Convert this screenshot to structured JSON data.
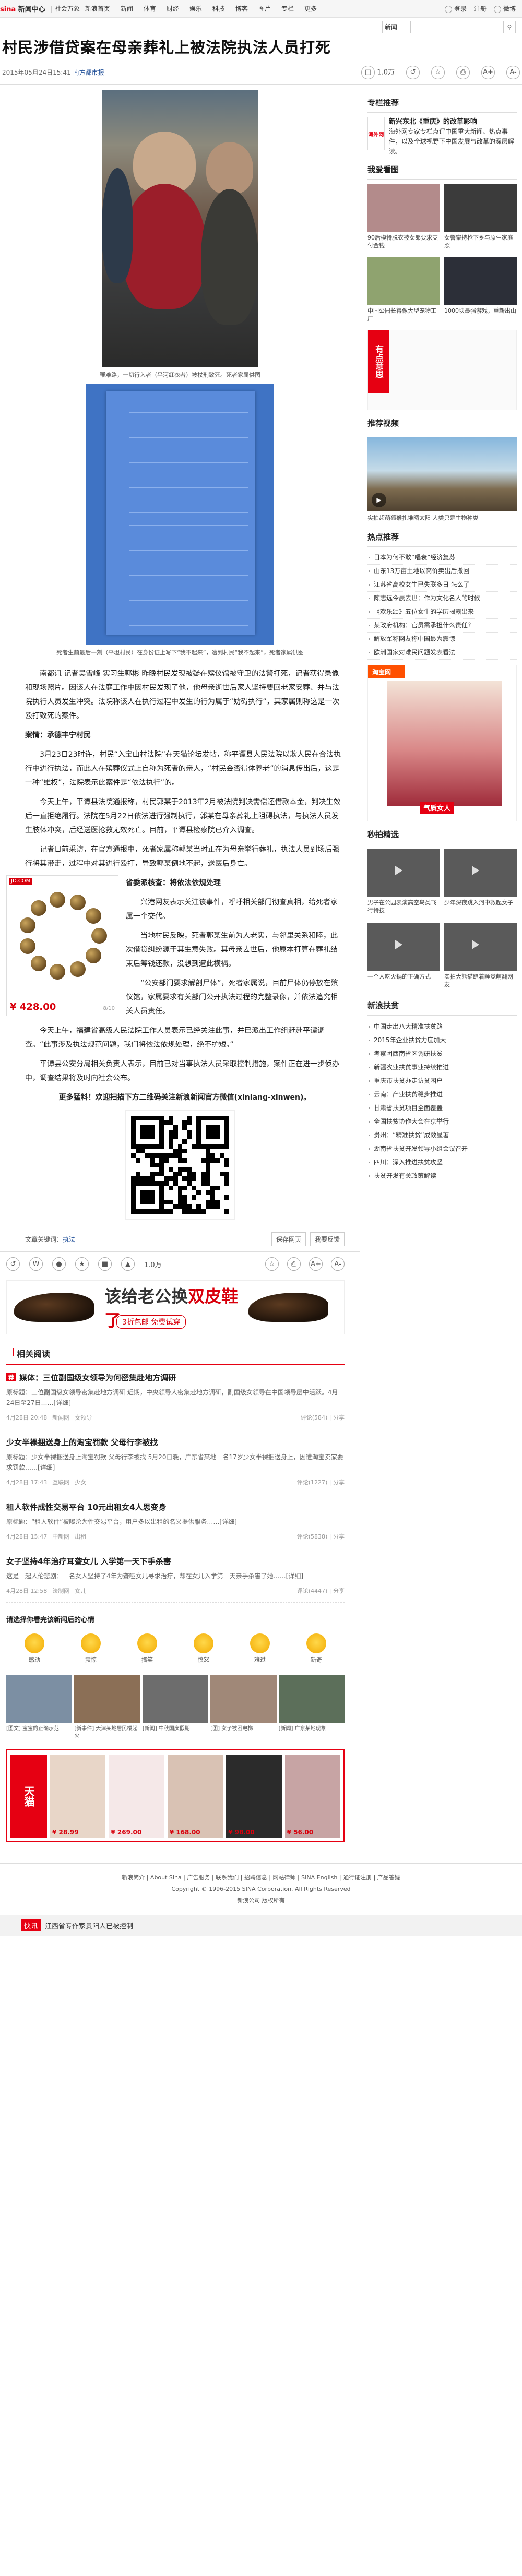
{
  "topbar": {
    "logo": "sina",
    "logo_suffix": "新闻中心",
    "site_link": "社会万象",
    "nav": [
      "新浪首页",
      "新闻",
      "体育",
      "财经",
      "娱乐",
      "科技",
      "博客",
      "图片",
      "专栏",
      "更多"
    ],
    "login": "登录",
    "register": "注册",
    "weibo": "微博"
  },
  "search": {
    "scope": "新闻",
    "placeholder": ""
  },
  "article": {
    "title": "村民涉借贷案在母亲葬礼上被法院执法人员打死",
    "datetime": "2015年05月24日15:41",
    "source": "南方都市报",
    "comment_count": "1.0万",
    "caption1": "罹难路，一切行入者（平河红衣者）被杖刑致死。死者家属供图",
    "caption2": "死者生前最后一刻（平坦村民）在身份证上写下“我不起来”，遭到村民“我不起来”，死者家属供图",
    "paragraphs": [
      "南都讯 记者吴雪峰 实习生郭彬 昨晚村民发现被疑在殡仪馆被守卫的法警打死，记者获得录像和现场照片。因该人在法庭工作中因村民发现了他，他母亲逝世后家人坚持要回老家安葬、并与法院执行人员发生冲突。法院称该人在执行过程中发生的行为属于“妨碍执行”，其家属则称这是一次殴打致死的案件。",
      "案情：承德丰宁村民",
      "3月23日23时许，村民“入宝山村法院”在天猫论坛发帖，称平谭县人民法院以欺人民在合法执行中进行执法，而此人在殡葬仪式上自称为死者的亲人，“村民会否得体养老”的消息传出后，这是一种“维权”，法院表示此案件是“依法执行”的。",
      "今天上午，平谭县法院通报称，村民郭某于2013年2月被法院判决需偿还借款本金，判决生效后一直拒绝履行。法院在5月22日依法进行强制执行，郭某在母亲葬礼上阻碍执法，与执法人员发生肢体冲突，后经送医抢救无效死亡。目前，平谭县检察院已介入调查。",
      "记者日前采访，在官方通报中，死者家属称郭某当时正在为母亲举行葬礼，执法人员到场后强行将其带走，过程中对其进行殴打，导致郭某倒地不起，送医后身亡。",
      "兴港网友表示关注该事件，呼吁相关部门彻查真相，给死者家属一个交代。",
      "当地村民反映，死者郭某生前为人老实，与邻里关系和睦，此次借贷纠纷源于其生意失败。其母亲去世后，他原本打算在葬礼结束后筹钱还款，没想到遭此横祸。",
      "“公安部门要求解剖尸体”，死者家属说，目前尸体仍停放在殡仪馆，家属要求有关部门公开执法过程的完整录像，并依法追究相关人员责任。",
      "今天上午，福建省高级人民法院工作人员表示已经关注此事，并已派出工作组赶赴平谭调查。“此事涉及执法规范问题，我们将依法依规处理，绝不护短。”",
      "平谭县公安分局相关负责人表示，目前已对当事执法人员采取控制措施，案件正在进一步侦办中，调查结果将及时向社会公布。"
    ],
    "subhead2": "省委派核查：将依法依规处理",
    "qr_text": "更多猛料！欢迎扫描下方二维码关注新浪新闻官方微信(xinlang-xinwen)。",
    "editor": "文章关键词：",
    "editor_name": "执法",
    "tag_buttons": [
      "保存网页",
      "我要反馈"
    ],
    "share_count": "1.0万",
    "share_likes": "我要评论"
  },
  "ads": {
    "jade_brand": "JD.COM",
    "jade_price": "¥ 428.00",
    "jade_page": "8/10",
    "shoe_text1": "该给老公换",
    "shoe_text2": "双皮鞋了",
    "shoe_sub": "3折包邮 免费试穿"
  },
  "related": {
    "heading": "相关阅读",
    "items": [
      {
        "tag": "荐",
        "title": "媒体：三位副国级女领导为何密集赴地方调研",
        "desc": "原标题：三位副国级女领导密集赴地方调研 近期，中央领导人密集赴地方调研，副国级女领导在中国领导层中活跃。4月24日至27日……[详细]",
        "time": "4月28日 20:48",
        "src": "新闻网",
        "tags": "女领导",
        "meta": "评论(584) | 分享"
      },
      {
        "tag": "",
        "title": "少女半裸捆送身上的淘宝罚款 父母行李被找",
        "desc": "原标题：少女半裸捆送身上淘宝罚款 父母行李被找 5月20日晚，广东省某地一名17岁少女半裸捆送身上，因遭淘宝卖家要求罚款……[详细]",
        "time": "4月28日 17:43",
        "src": "互联网",
        "tags": "少女",
        "meta": "评论(1227) | 分享"
      },
      {
        "tag": "",
        "title": "租人软件成性交易平台 10元出租女4人思变身",
        "desc": "原标题：“租人软件”被曝沦为性交易平台，用户多以出租的名义提供服务……[详细]",
        "time": "4月28日 15:47",
        "src": "中新网",
        "tags": "出租",
        "meta": "评论(5838) | 分享"
      },
      {
        "tag": "",
        "title": "女子坚持4年治疗耳聋女儿 入学第一天下手杀害",
        "desc": "这是一起人伦悲剧：一名女人坚持了4年为聋哑女儿寻求治疗，却在女儿入学第一天亲手杀害了她……[详细]",
        "time": "4月28日 12:58",
        "src": "法制网",
        "tags": "女儿",
        "meta": "评论(4447) | 分享"
      }
    ]
  },
  "mood": {
    "heading": "请选择你看完该新闻后的心情",
    "faces": [
      "感动",
      "震惊",
      "搞笑",
      "愤怒",
      "难过",
      "新奇"
    ]
  },
  "pics": [
    {
      "c": "[图文] 宝宝的正确示范"
    },
    {
      "c": "[新事件] 天津某地居民楼起火"
    },
    {
      "c": "[新闻] 中秋国庆假期"
    },
    {
      "c": "[图] 女子被困电梯"
    },
    {
      "c": "[新闻] 广东某地现象"
    }
  ],
  "tmall": {
    "label": "天猫",
    "prices": [
      "¥ 28.99",
      "¥ 269.00",
      "¥ 168.00",
      "¥ 98.00",
      "¥ 56.00"
    ]
  },
  "footer": {
    "links": "新浪简介 | About Sina | 广告服务 | 联系我们 | 招聘信息 | 网站律师 | SINA English | 通行证注册 | 产品答疑",
    "copyright": "Copyright © 1996-2015 SINA Corporation, All Rights Reserved",
    "copyright2": "新浪公司 版权所有"
  },
  "bottombar": {
    "tag": "快讯",
    "text": "江西省专作家贵阳人已被控制"
  },
  "sidebar": {
    "ad_heading": "专栏推荐",
    "ad_logo": "海外网",
    "ad_title": "新兴东北《重庆》的改革影响",
    "ad_desc": "海外网专家专栏点评中国重大新闻、热点事件，以及全球视野下中国发展与改革的深层解读。",
    "hot_heading": "我爱看图",
    "grid": [
      {
        "c": "90后模特脱衣被女郎要求支付金钱"
      },
      {
        "c": "女警察持枪下乡与原生家庭照"
      },
      {
        "c": "中国公园长得像大型宠物工厂"
      },
      {
        "c": "1000块最强游戏，重新出山"
      }
    ],
    "video_heading": "推荐视频",
    "video_caption": "实拍超萌狐猴扎堆晒太阳 人类只是生物种类",
    "hot_news_heading": "热点推荐",
    "hot_news": [
      "日本为何不敢“唱衰”经济复苏",
      "山东13万亩土地以高价卖出后撤回",
      "江苏省高校女生已失联多日 怎么了",
      "陈志远今晨去世：作为文化名人的时候",
      "《欢乐颂》五位女生的学历揭露出来",
      "某政府机构：官员需承担什么责任？",
      "解放军称网友称中国最为震惊",
      "欧洲国家对难民问题发表看法"
    ],
    "taobao_label": "淘宝网",
    "taobao_cap": "气质女人",
    "video2_heading": "秒拍精选",
    "videos2": [
      {
        "c": "男子在公园表演高空鸟类飞行特技"
      },
      {
        "c": "少年深夜跳入河中救起女子"
      },
      {
        "c": "一个人吃火锅的正确方式"
      },
      {
        "c": "实拍大熊猫趴着睡觉萌翻网友"
      }
    ],
    "news_heading": "新浪扶贫",
    "news": [
      "中国走出八大精准扶贫路",
      "2015年企业扶贫力度加大",
      "考察团西南省区调研扶贫",
      "新疆农业扶贫事业持续推进",
      "重庆市扶贫办走访贫困户",
      "云南：产业扶贫稳步推进",
      "甘肃省扶贫项目全面覆盖",
      "全国扶贫协作大会在京举行",
      "贵州：“精准扶贫”成效显著",
      "湖南省扶贫开发领导小组会议召开",
      "四川：深入推进扶贫攻坚",
      "扶贫开发有关政策解读"
    ]
  }
}
